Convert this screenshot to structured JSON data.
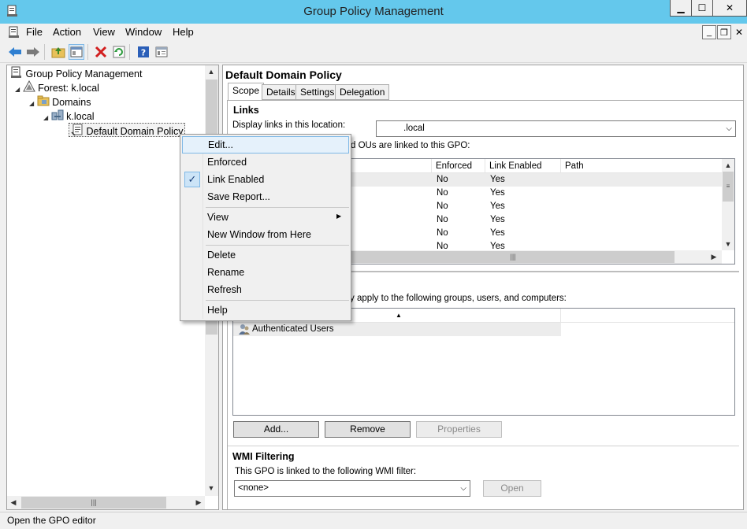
{
  "window": {
    "title": "Group Policy Management"
  },
  "menu": {
    "items": [
      "File",
      "Action",
      "View",
      "Window",
      "Help"
    ]
  },
  "toolbar": {
    "buttons": [
      "back-icon",
      "forward-icon",
      "up-folder-icon",
      "show-hide-tree-icon",
      "delete-icon",
      "refresh-icon",
      "help-icon",
      "properties-icon"
    ]
  },
  "tree": {
    "root": "Group Policy Management",
    "forest": "Forest: k.local",
    "domains": "Domains",
    "domain": "k.local",
    "gpo": "Default Domain Policy"
  },
  "gpo_pane": {
    "title": "Default Domain Policy",
    "tabs": [
      "Scope",
      "Details",
      "Settings",
      "Delegation"
    ],
    "links": {
      "heading": "Links",
      "display_label": "Display links in this location:",
      "display_value": ".local",
      "linked_text": "d OUs are linked to this GPO:",
      "columns": [
        "Enforced",
        "Link Enabled",
        "Path"
      ],
      "rows": [
        {
          "enforced": "No",
          "link_enabled": "Yes"
        },
        {
          "enforced": "No",
          "link_enabled": "Yes"
        },
        {
          "enforced": "No",
          "link_enabled": "Yes"
        },
        {
          "enforced": "No",
          "link_enabled": "Yes"
        },
        {
          "enforced": "No",
          "link_enabled": "Yes"
        },
        {
          "enforced": "No",
          "link_enabled": "Yes"
        }
      ]
    },
    "security": {
      "apply_text": "y apply to the following groups, users, and computers:",
      "rows": [
        "Authenticated Users"
      ],
      "add_label": "Add...",
      "remove_label": "Remove",
      "properties_label": "Properties"
    },
    "wmi": {
      "heading": "WMI Filtering",
      "text": "This GPO is linked to the following WMI filter:",
      "value": "<none>",
      "open_label": "Open"
    }
  },
  "context_menu": {
    "items": {
      "edit": "Edit...",
      "enforced": "Enforced",
      "link_enabled": "Link Enabled",
      "save_report": "Save Report...",
      "view": "View",
      "new_window": "New Window from Here",
      "delete": "Delete",
      "rename": "Rename",
      "refresh": "Refresh",
      "help": "Help"
    }
  },
  "status": {
    "text": "Open the GPO editor"
  },
  "colors": {
    "titlebar": "#64c8ec",
    "highlight": "#e5f1fb",
    "accent": "#0078d7"
  }
}
